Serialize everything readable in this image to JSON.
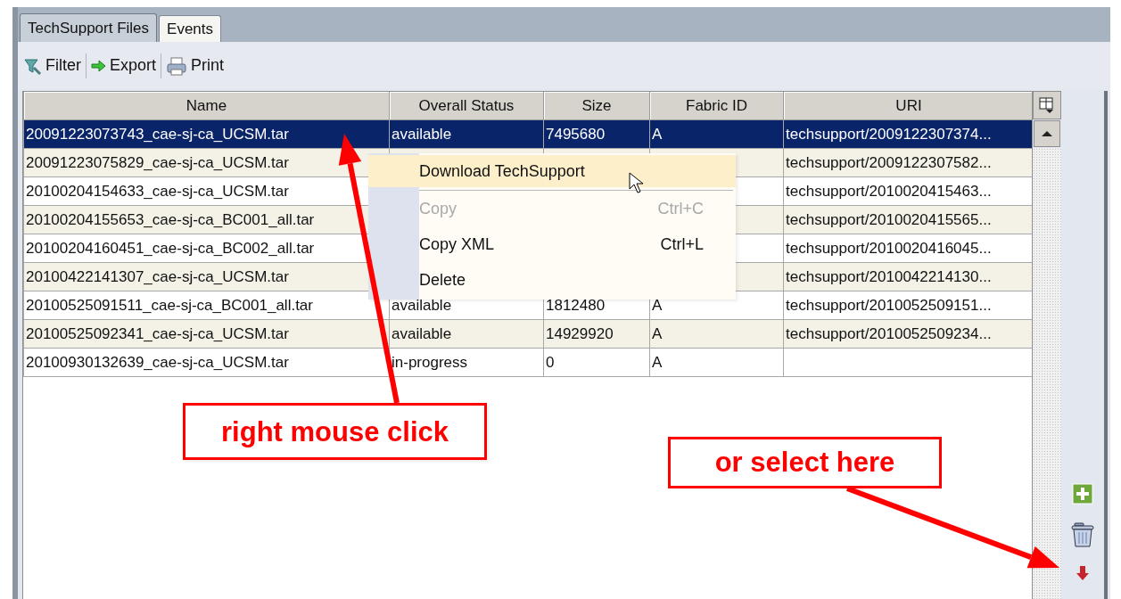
{
  "tabs": [
    {
      "label": "TechSupport Files",
      "selected": true
    },
    {
      "label": "Events",
      "selected": false
    }
  ],
  "toolbar": [
    {
      "kind": "filter",
      "label": "Filter"
    },
    {
      "kind": "export",
      "label": "Export"
    },
    {
      "kind": "print",
      "label": "Print"
    }
  ],
  "table": {
    "columns": [
      "Name",
      "Overall Status",
      "Size",
      "Fabric ID",
      "URI"
    ],
    "rows": [
      {
        "name": "20091223073743_cae-sj-ca_UCSM.tar",
        "status": "available",
        "size": "7495680",
        "fabric_id": "A",
        "uri": "techsupport/2009122307374...",
        "selected": true
      },
      {
        "name": "20091223075829_cae-sj-ca_UCSM.tar",
        "uri": "techsupport/2009122307582...",
        "selected": false
      },
      {
        "name": "20100204154633_cae-sj-ca_UCSM.tar",
        "uri": "techsupport/2010020415463...",
        "selected": false
      },
      {
        "name": "20100204155653_cae-sj-ca_BC001_all.tar",
        "uri": "techsupport/2010020415565...",
        "selected": false
      },
      {
        "name": "20100204160451_cae-sj-ca_BC002_all.tar",
        "uri": "techsupport/2010020416045...",
        "selected": false
      },
      {
        "name": "20100422141307_cae-sj-ca_UCSM.tar",
        "uri": "techsupport/2010042214130...",
        "selected": false
      },
      {
        "name": "20100525091511_cae-sj-ca_BC001_all.tar",
        "status": "available",
        "size": "1812480",
        "fabric_id": "A",
        "uri": "techsupport/2010052509151...",
        "selected": false
      },
      {
        "name": "20100525092341_cae-sj-ca_UCSM.tar",
        "status": "available",
        "size": "14929920",
        "fabric_id": "A",
        "uri": "techsupport/2010052509234...",
        "selected": false
      },
      {
        "name": "20100930132639_cae-sj-ca_UCSM.tar",
        "status": "in-progress",
        "size": "0",
        "fabric_id": "A",
        "selected": false
      }
    ]
  },
  "context_menu": {
    "items": [
      {
        "label": "Download TechSupport",
        "highlighted": true,
        "disabled": false
      },
      {
        "label": "Copy",
        "shortcut": "Ctrl+C",
        "highlighted": false,
        "disabled": true
      },
      {
        "label": "Copy XML",
        "shortcut": "Ctrl+L",
        "highlighted": false,
        "disabled": false
      },
      {
        "label": "Delete",
        "highlighted": false,
        "disabled": false
      }
    ]
  },
  "side_actions": [
    {
      "kind": "add"
    },
    {
      "kind": "delete"
    },
    {
      "kind": "download"
    }
  ],
  "annotations": [
    {
      "kind": "menu",
      "text": "right mouse click"
    },
    {
      "kind": "side",
      "text": "or select here"
    }
  ]
}
